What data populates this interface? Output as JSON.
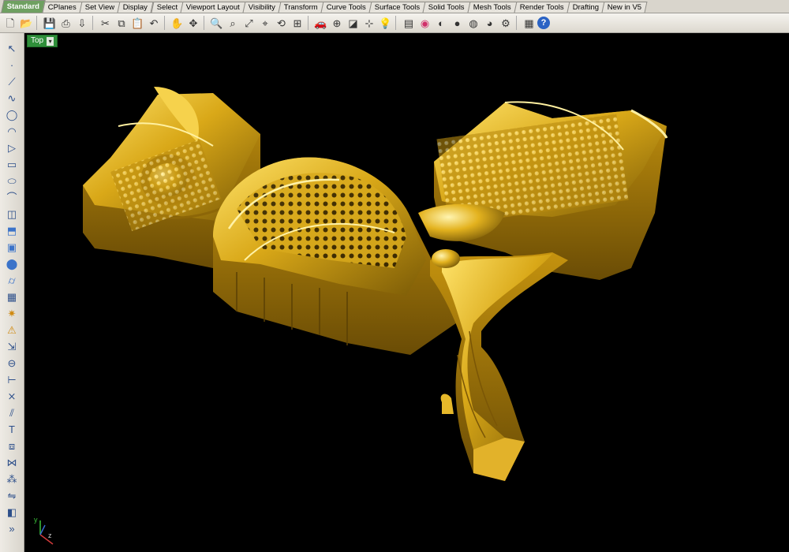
{
  "tabs": [
    {
      "label": "Standard",
      "active": true
    },
    {
      "label": "CPlanes"
    },
    {
      "label": "Set View"
    },
    {
      "label": "Display"
    },
    {
      "label": "Select"
    },
    {
      "label": "Viewport Layout"
    },
    {
      "label": "Visibility"
    },
    {
      "label": "Transform"
    },
    {
      "label": "Curve Tools"
    },
    {
      "label": "Surface Tools"
    },
    {
      "label": "Solid Tools"
    },
    {
      "label": "Mesh Tools"
    },
    {
      "label": "Render Tools"
    },
    {
      "label": "Drafting"
    },
    {
      "label": "New in V5"
    }
  ],
  "toolbar_icons": [
    "new-file-icon",
    "open-file-icon",
    "save-icon",
    "print-icon",
    "import-icon",
    "cut-icon",
    "copy-icon",
    "paste-icon",
    "undo-icon",
    "pan-icon",
    "move-icon",
    "zoom-icon",
    "zoom-window-icon",
    "zoom-extents-icon",
    "zoom-selected-icon",
    "rotate-view-icon",
    "four-viewports-icon",
    "car-icon",
    "cplane-icon",
    "perspective-icon",
    "snap-icon",
    "light-bulb-icon",
    "layer-icon",
    "color-wheel-icon",
    "shade-icon",
    "render-icon",
    "material-sphere-icon",
    "env-sphere-icon",
    "gear-icon",
    "properties-icon",
    "help-icon"
  ],
  "left_tool_icons": [
    "select-arrow-icon",
    "point-icon",
    "polyline-icon",
    "curve-icon",
    "circle-icon",
    "arc-icon",
    "polygon-icon",
    "rectangle-icon",
    "ellipse-icon",
    "fillet-icon",
    "surface-edge-icon",
    "extrude-icon",
    "box-icon",
    "sphere-icon",
    "cylinder-icon",
    "mesh-icon",
    "explode-icon",
    "analyze-icon",
    "transform-icon",
    "boolean-icon",
    "dimension-icon",
    "trim-icon",
    "split-icon",
    "text-icon",
    "group-icon",
    "join-icon",
    "array-icon",
    "mirror-icon",
    "solid-edit-icon",
    "more-icon"
  ],
  "viewport": {
    "name": "Top",
    "background": "#000000",
    "model_color": "#c99a12",
    "axis_labels": {
      "y": "y",
      "z": "z"
    }
  }
}
